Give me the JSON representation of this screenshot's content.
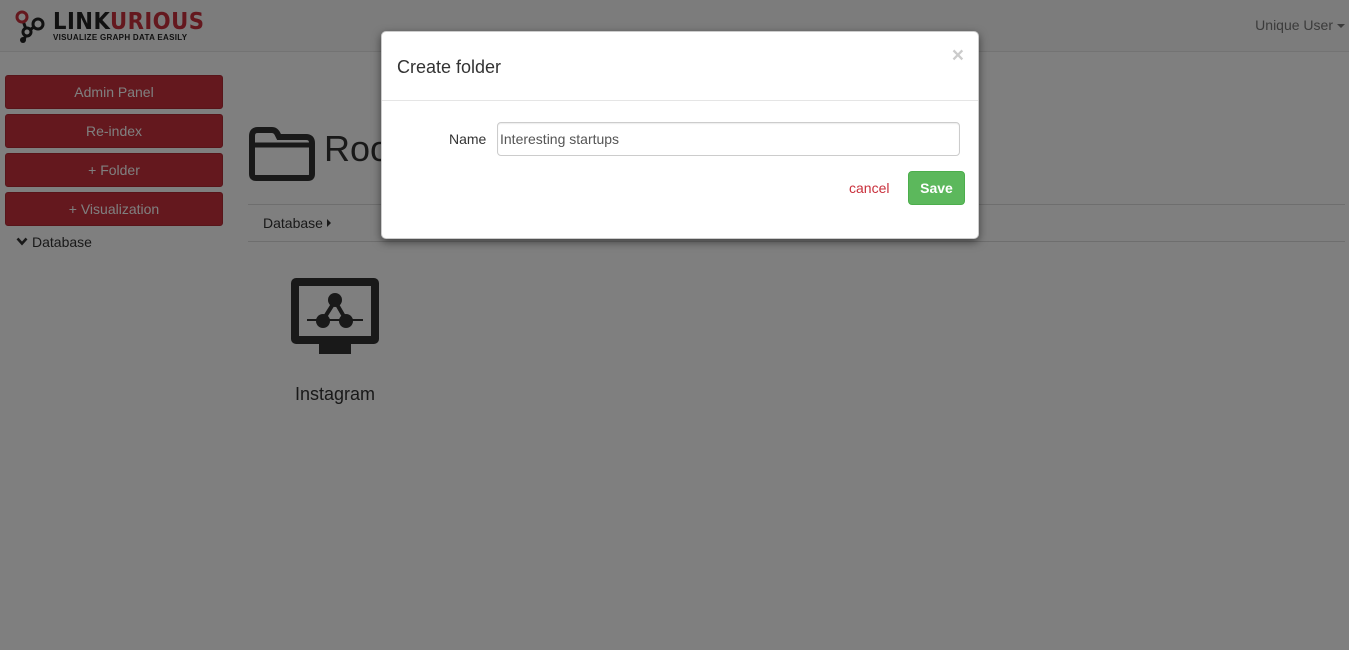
{
  "navbar": {
    "logo_word_main": "LINK",
    "logo_word_accent": "URIOUS",
    "logo_tagline": "VISUALIZE GRAPH DATA EASILY",
    "user_label": "Unique User"
  },
  "sidebar": {
    "buttons": [
      {
        "label": "Admin Panel"
      },
      {
        "label": "Re-index"
      },
      {
        "label": "+ Folder"
      },
      {
        "label": "+ Visualization"
      }
    ],
    "tree_root": "Database"
  },
  "main": {
    "page_title": "Root",
    "breadcrumb": "Database",
    "visualizations": [
      {
        "label": "Instagram",
        "icon": "graph-visualization-icon"
      }
    ]
  },
  "modal": {
    "title": "Create folder",
    "close_symbol": "×",
    "name_label": "Name",
    "name_value": "Interesting startups",
    "cancel_label": "cancel",
    "save_label": "Save"
  },
  "colors": {
    "brand": "#c9303c",
    "success": "#5cb85c",
    "backdrop": "rgba(0,0,0,0.5)"
  }
}
